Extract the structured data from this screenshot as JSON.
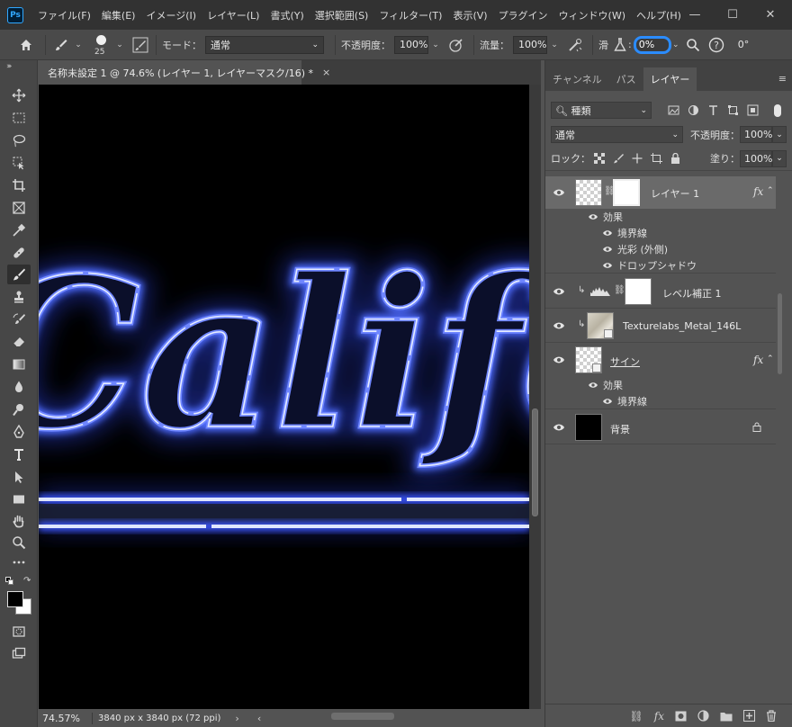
{
  "app": {
    "logo": "Ps"
  },
  "menu": [
    "ファイル(F)",
    "編集(E)",
    "イメージ(I)",
    "レイヤー(L)",
    "書式(Y)",
    "選択範囲(S)",
    "フィルター(T)",
    "表示(V)",
    "プラグイン",
    "ウィンドウ(W)",
    "ヘルプ(H)"
  ],
  "window_controls": {
    "minimize": "—",
    "maximize": "☐",
    "close": "✕"
  },
  "options": {
    "brush_size": "25",
    "mode_label": "モード：",
    "mode_value": "通常",
    "opacity_label": "不透明度：",
    "opacity_value": "100%",
    "flow_label": "流量：",
    "flow_value": "100%",
    "smoothing_label": "滑",
    "smoothing_value": "0%",
    "angle_value": "0°"
  },
  "document": {
    "tab_title": "名称未設定 1 @ 74.6% (レイヤー 1, レイヤーマスク/16) *",
    "tab_close": "×",
    "zoom": "74.57%",
    "dimensions": "3840 px x 3840 px (72 ppi)",
    "canvas_text": "Califor"
  },
  "panel": {
    "tabs": [
      "チャンネル",
      "パス",
      "レイヤー"
    ],
    "active_tab": "レイヤー",
    "filter_kind": "種類",
    "blend_mode": "通常",
    "opacity_label": "不透明度：",
    "opacity_value": "100%",
    "lock_label": "ロック：",
    "fill_label": "塗り：",
    "fill_value": "100%"
  },
  "layers": [
    {
      "name": "レイヤー 1",
      "fx": "fx",
      "effects_label": "効果",
      "effects": [
        "境界線",
        "光彩 (外側)",
        "ドロップシャドウ"
      ]
    },
    {
      "name": "レベル補正 1"
    },
    {
      "name": "Texturelabs_Metal_146L"
    },
    {
      "name": "サイン",
      "fx": "fx",
      "effects_label": "効果",
      "effects": [
        "境界線"
      ]
    },
    {
      "name": "背景"
    }
  ],
  "colors": {
    "accent_highlight": "#2b8cff",
    "neon": "#5a7cff",
    "neon_core": "#e6ecff"
  }
}
